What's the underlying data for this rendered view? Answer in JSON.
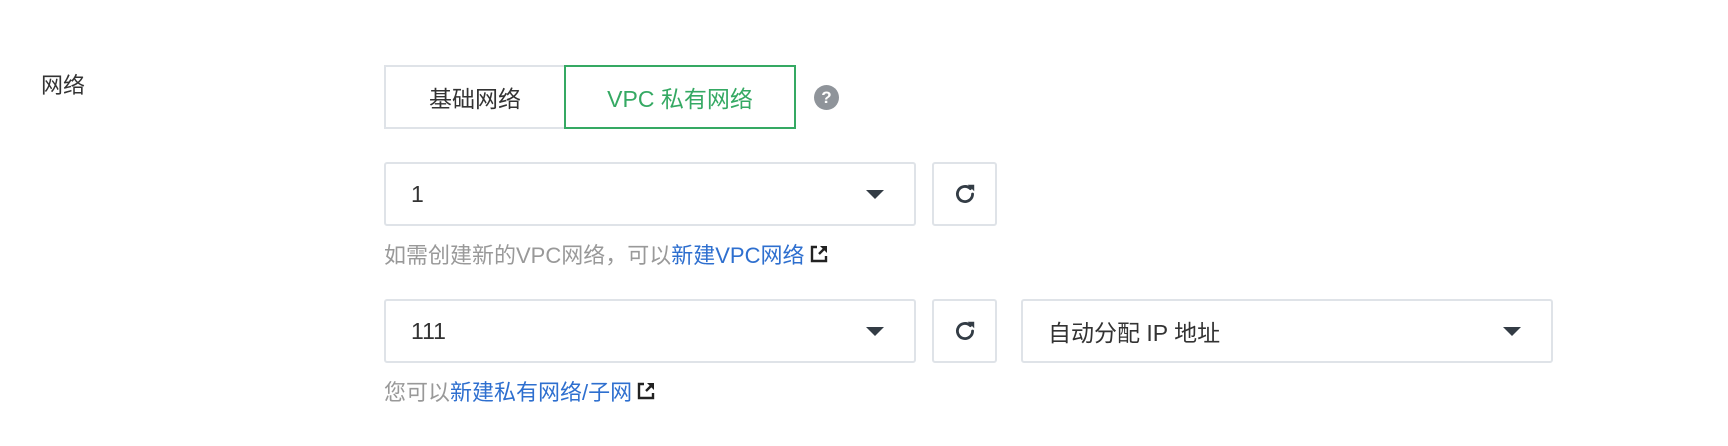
{
  "network": {
    "label": "网络",
    "types": [
      {
        "label": "基础网络",
        "selected": false
      },
      {
        "label": "VPC 私有网络",
        "selected": true
      }
    ],
    "help_icon": "question-circle-icon",
    "help_glyph": "?"
  },
  "vpc": {
    "selected": "1",
    "hint_prefix": "如需创建新的VPC网络，可以 ",
    "link_label": "新建VPC网络",
    "link_icon": "external-link-icon"
  },
  "subnet": {
    "selected": "111",
    "ip_mode": "自动分配 IP 地址",
    "hint_prefix": "您可以 ",
    "link_label": "新建私有网络/子网",
    "link_icon": "external-link-icon"
  },
  "icons": {
    "refresh": "refresh-icon",
    "caret": "caret-down-icon"
  },
  "colors": {
    "accent_green": "#35a963",
    "link_blue": "#2e6fcf",
    "border": "#dfe3e8",
    "hint_gray": "#999999"
  }
}
